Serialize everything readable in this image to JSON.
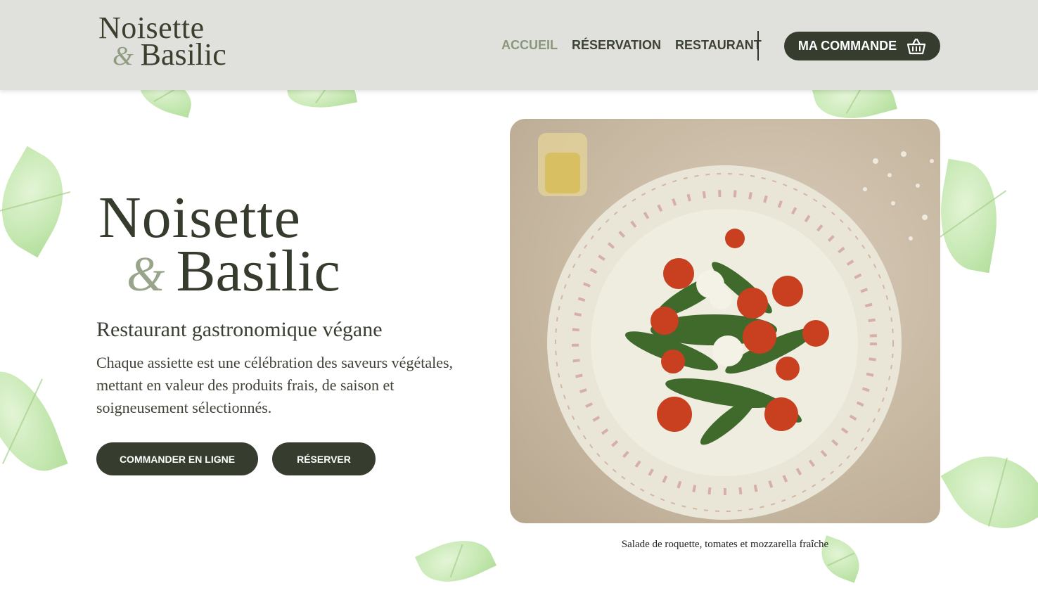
{
  "header": {
    "logo_line1": "Noisette",
    "logo_amp": "&",
    "logo_line2": "Basilic",
    "nav": [
      {
        "label": "ACCUEIL",
        "active": true
      },
      {
        "label": "RÉSERVATION",
        "active": false
      },
      {
        "label": "RESTAURANT",
        "active": false
      }
    ],
    "cart_label": "MA COMMANDE",
    "cart_icon": "basket-icon"
  },
  "hero": {
    "logo_line1": "Noisette",
    "logo_amp": "&",
    "logo_line2": "Basilic",
    "subtitle": "Restaurant gastronomique végane",
    "description": "Chaque assiette est une célébration des saveurs végétales, mettant en valeur des produits frais, de saison et soigneusement sélectionnés.",
    "order_button": "COMMANDER EN LIGNE",
    "reserve_button": "RÉSERVER"
  },
  "photo": {
    "caption": "Salade de roquette, tomates et mozzarella fraîche"
  },
  "colors": {
    "header_bg": "#e0e1dc",
    "dark_green": "#363d2f",
    "sage": "#8e9c80"
  }
}
